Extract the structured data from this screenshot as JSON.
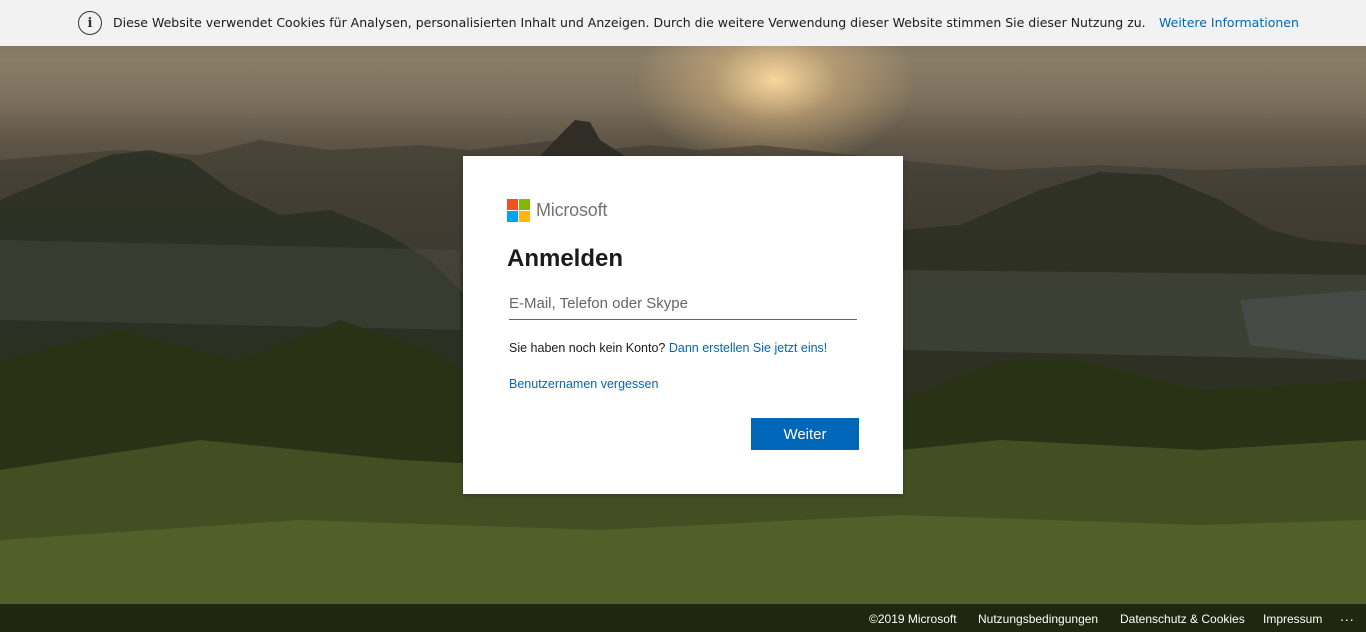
{
  "cookie_banner": {
    "icon": "info-icon",
    "text": "Diese Website verwendet Cookies für Analysen, personalisierten Inhalt und Anzeigen. Durch die weitere Verwendung dieser Website stimmen Sie dieser Nutzung zu.",
    "link_label": "Weitere Informationen"
  },
  "card": {
    "logo_text": "Microsoft",
    "logo_colors": [
      "#f25022",
      "#7fba00",
      "#00a4ef",
      "#ffb900"
    ],
    "title": "Anmelden",
    "email_placeholder": "E-Mail, Telefon oder Skype",
    "no_account_text": "Sie haben noch kein Konto?",
    "create_account_link": "Dann erstellen Sie jetzt eins!",
    "forgot_username_link": "Benutzernamen vergessen",
    "next_button": "Weiter"
  },
  "footer": {
    "copyright": "©2019 Microsoft",
    "terms": "Nutzungsbedingungen",
    "privacy": "Datenschutz & Cookies",
    "imprint": "Impressum",
    "more": "..."
  },
  "colors": {
    "accent": "#0067b8",
    "banner_bg": "#f2f2f2"
  }
}
